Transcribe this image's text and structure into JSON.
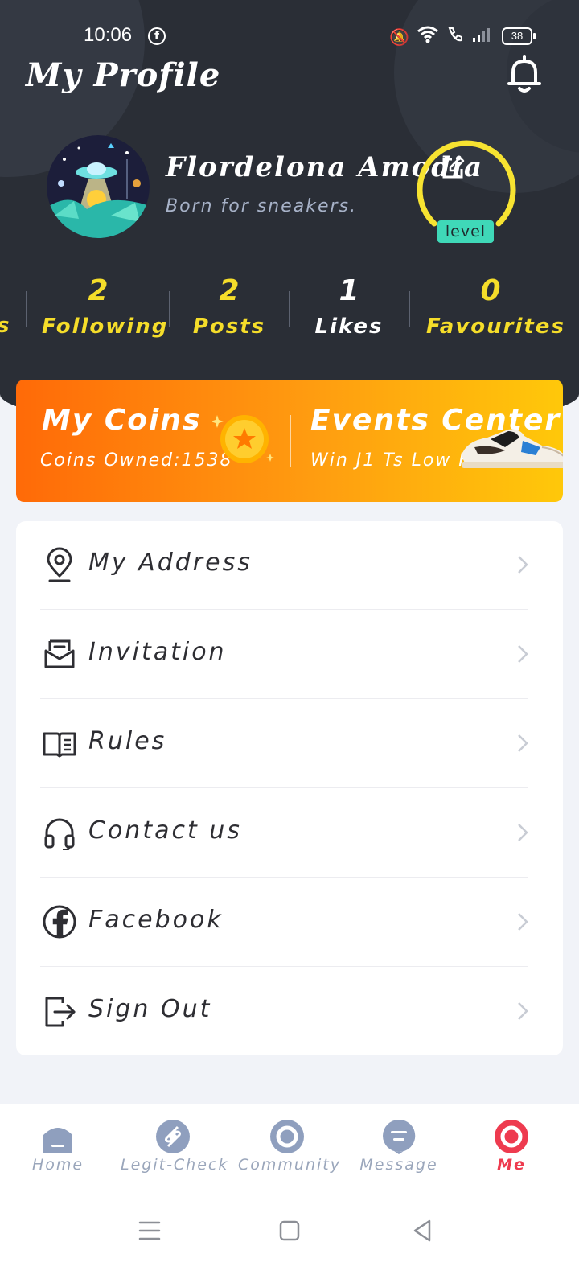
{
  "status_bar": {
    "time": "10:06",
    "battery": "38"
  },
  "header": {
    "title": "My Profile"
  },
  "profile": {
    "name": "Flordelona Amodia",
    "bio": "Born for sneakers.",
    "level_label": "level"
  },
  "stats": {
    "cut_off": "s",
    "items": [
      {
        "value": "2",
        "label": "Following"
      },
      {
        "value": "2",
        "label": "Posts"
      },
      {
        "value": "1",
        "label": "Likes"
      },
      {
        "value": "0",
        "label": "Favourites"
      }
    ]
  },
  "promo": {
    "coins_title": "My Coins",
    "coins_sub": "Coins Owned:1538",
    "events_title": "Events Center",
    "events_sub": "Win J1 Ts Low Free!"
  },
  "menu": {
    "items": [
      {
        "label": "My Address",
        "icon": "location-pin-icon"
      },
      {
        "label": "Invitation",
        "icon": "envelope-icon"
      },
      {
        "label": "Rules",
        "icon": "book-icon"
      },
      {
        "label": "Contact us",
        "icon": "headset-icon"
      },
      {
        "label": "Facebook",
        "icon": "facebook-icon"
      },
      {
        "label": "Sign Out",
        "icon": "sign-out-icon"
      }
    ]
  },
  "tabs": [
    {
      "label": "Home",
      "icon": "home-icon"
    },
    {
      "label": "Legit-Check",
      "icon": "legit-check-icon"
    },
    {
      "label": "Community",
      "icon": "community-icon"
    },
    {
      "label": "Message",
      "icon": "message-icon"
    },
    {
      "label": "Me",
      "icon": "me-icon",
      "active": true
    }
  ],
  "colors": {
    "hero_bg": "#2a2e36",
    "accent_yellow": "#f5dd2a",
    "level_green": "#3fd8b8",
    "promo_orange": "#ff6a08",
    "promo_yellow": "#ffc80a",
    "active_tab": "#ee3b4f",
    "inactive_tab": "#9aa6bb"
  }
}
